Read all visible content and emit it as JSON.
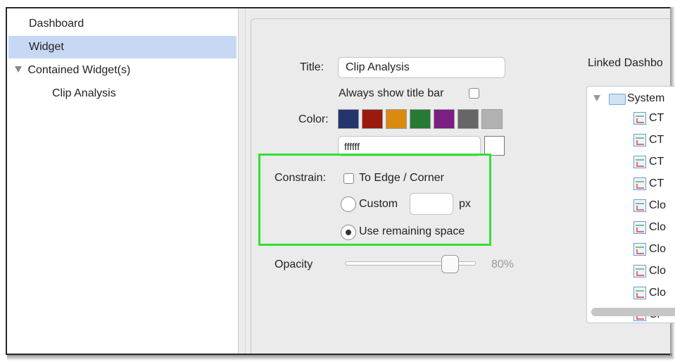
{
  "sidebar": {
    "items": [
      {
        "label": "Dashboard"
      },
      {
        "label": "Widget"
      },
      {
        "label": "Contained Widget(s)"
      },
      {
        "label": "Clip Analysis"
      }
    ]
  },
  "form": {
    "title_label": "Title:",
    "title_value": "Clip Analysis",
    "always_show_label": "Always show title bar",
    "color_label": "Color:",
    "colors": [
      "#23356c",
      "#9a1b0d",
      "#d98a10",
      "#277a33",
      "#7c1e82",
      "#666666",
      "#b2b2b2"
    ],
    "hex_value": "ffffff",
    "constrain_label": "Constrain:",
    "to_edge_label": "To Edge / Corner",
    "custom_label": "Custom",
    "custom_value": "",
    "px_label": "px",
    "use_remaining_label": "Use remaining space",
    "opacity_label": "Opacity",
    "opacity_value": "80%",
    "opacity_level": 0.8
  },
  "linked": {
    "header": "Linked Dashbo",
    "root": "System",
    "items": [
      "CT",
      "CT",
      "CT",
      "CT",
      "Clo",
      "Clo",
      "Clo",
      "Clo",
      "Clo",
      "Cl"
    ]
  },
  "highlight_color": "#33e033"
}
